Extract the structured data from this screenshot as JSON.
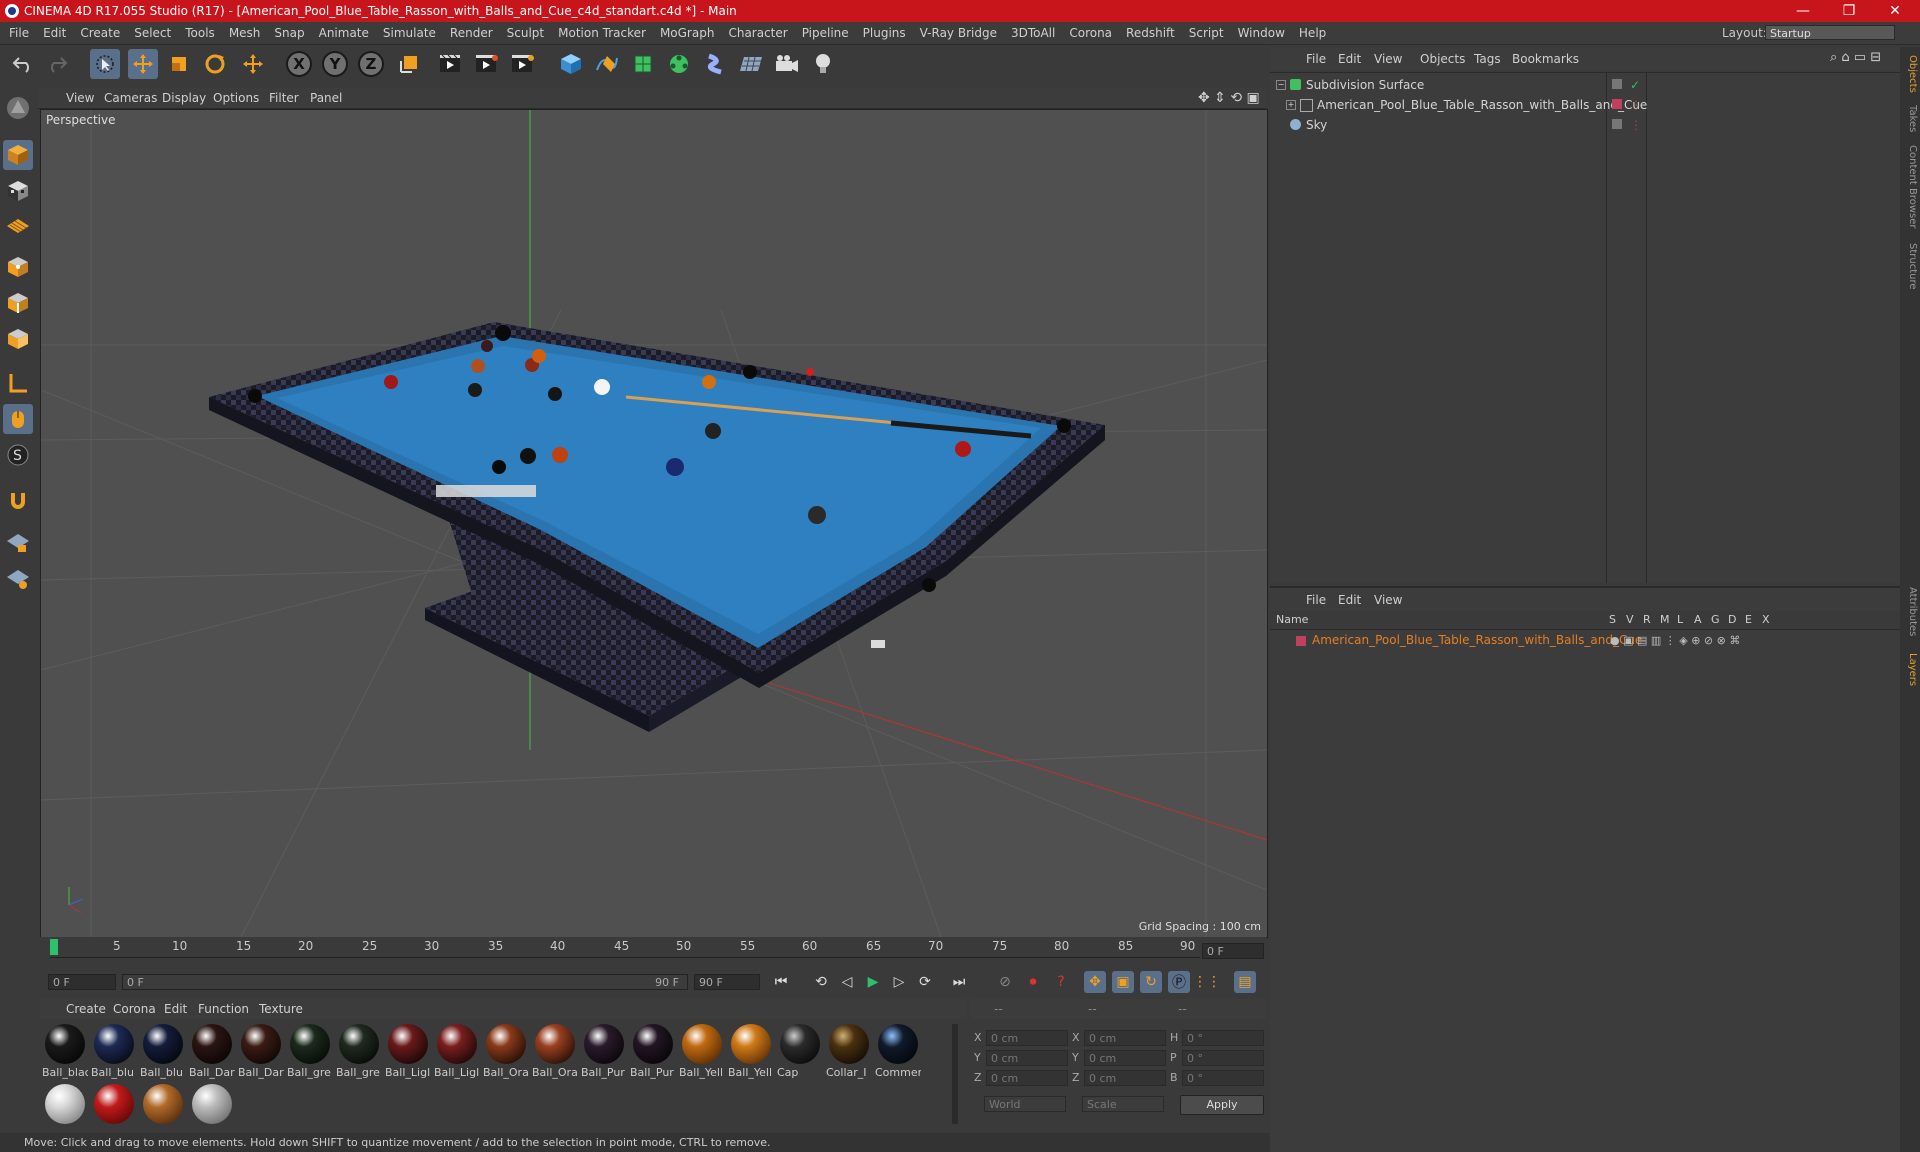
{
  "title_bar": {
    "title": "CINEMA 4D R17.055 Studio (R17) - [American_Pool_Blue_Table_Rasson_with_Balls_and_Cue_c4d_standart.c4d *] - Main",
    "minimize": "—",
    "maximize": "❐",
    "close": "✕"
  },
  "menubar": {
    "items": [
      "File",
      "Edit",
      "Create",
      "Select",
      "Tools",
      "Mesh",
      "Snap",
      "Animate",
      "Simulate",
      "Render",
      "Sculpt",
      "Motion Tracker",
      "MoGraph",
      "Character",
      "Pipeline",
      "Plugins",
      "V-Ray Bridge",
      "3DToAll",
      "Corona",
      "Redshift",
      "Script",
      "Window",
      "Help"
    ],
    "layout_label": "Layout:",
    "layout_value": "Startup"
  },
  "toolbar": {
    "axis_x": "X",
    "axis_y": "Y",
    "axis_z": "Z"
  },
  "viewport": {
    "menu": [
      "View",
      "Cameras",
      "Display",
      "Options",
      "Filter",
      "Panel"
    ],
    "label": "Perspective",
    "grid_spacing": "Grid Spacing : 100 cm"
  },
  "timeline": {
    "ticks": [
      "0",
      "5",
      "10",
      "15",
      "20",
      "25",
      "30",
      "35",
      "40",
      "45",
      "50",
      "55",
      "60",
      "65",
      "70",
      "75",
      "80",
      "85",
      "90"
    ],
    "end_field": "0 F"
  },
  "transport": {
    "start_field": "0 F",
    "range_start": "0 F",
    "range_end": "90 F",
    "end_field": "90 F"
  },
  "material_manager": {
    "menu": [
      "Create",
      "Corona",
      "Edit",
      "Function",
      "Texture"
    ],
    "materials": [
      {
        "label": "Ball_blac",
        "color": "#1a1a1a"
      },
      {
        "label": "Ball_blu",
        "color": "#1e2a55"
      },
      {
        "label": "Ball_blu",
        "color": "#141c3a"
      },
      {
        "label": "Ball_Dar",
        "color": "#2a1512"
      },
      {
        "label": "Ball_Dar",
        "color": "#3a1c14"
      },
      {
        "label": "Ball_gre",
        "color": "#1c2a1c"
      },
      {
        "label": "Ball_gre",
        "color": "#202a20"
      },
      {
        "label": "Ball_Ligl",
        "color": "#6a1a1a"
      },
      {
        "label": "Ball_Ligl",
        "color": "#7a1e1e"
      },
      {
        "label": "Ball_Ora",
        "color": "#8a3a1a"
      },
      {
        "label": "Ball_Ora",
        "color": "#9a4020"
      },
      {
        "label": "Ball_Pur",
        "color": "#2a1a2a"
      },
      {
        "label": "Ball_Pur",
        "color": "#221522"
      },
      {
        "label": "Ball_Yell",
        "color": "#c06a10"
      },
      {
        "label": "Ball_Yell",
        "color": "#d07a18"
      },
      {
        "label": "Cap",
        "color": "#2a2a2a"
      },
      {
        "label": "Collar_I",
        "color": "#4a3010"
      },
      {
        "label": "Commer",
        "color": "#101a2a"
      },
      {
        "label": "",
        "color": "#d8d8d8"
      },
      {
        "label": "",
        "color": "#c01a1a"
      },
      {
        "label": "",
        "color": "#b06a2a"
      },
      {
        "label": "",
        "color": "#bcbcbc"
      }
    ]
  },
  "coordinates": {
    "header": [
      "--",
      "--",
      "--"
    ],
    "rows": [
      {
        "a": "X",
        "av": "0 cm",
        "b": "X",
        "bv": "0 cm",
        "c": "H",
        "cv": "0 °"
      },
      {
        "a": "Y",
        "av": "0 cm",
        "b": "Y",
        "bv": "0 cm",
        "c": "P",
        "cv": "0 °"
      },
      {
        "a": "Z",
        "av": "0 cm",
        "b": "Z",
        "bv": "0 cm",
        "c": "B",
        "cv": "0 °"
      }
    ],
    "world": "World",
    "scale": "Scale",
    "apply": "Apply"
  },
  "status": "Move: Click and drag to move elements. Hold down SHIFT to quantize movement / add to the selection in point mode, CTRL to remove.",
  "object_manager": {
    "menu": [
      "File",
      "Edit",
      "View",
      "Objects",
      "Tags",
      "Bookmarks"
    ],
    "objects": [
      {
        "name": "Subdivision Surface"
      },
      {
        "name": "American_Pool_Blue_Table_Rasson_with_Balls_and_Cue"
      },
      {
        "name": "Sky"
      }
    ]
  },
  "layer_manager": {
    "menu": [
      "File",
      "Edit",
      "View"
    ],
    "columns": [
      "Name",
      "S",
      "V",
      "R",
      "M",
      "L",
      "A",
      "G",
      "D",
      "E",
      "X"
    ],
    "layers": [
      {
        "name": "American_Pool_Blue_Table_Rasson_with_Balls_and_Cue",
        "color": "#e67e22"
      }
    ]
  },
  "side_tabs": [
    "Objects",
    "Takes",
    "Content Browser",
    "Structure",
    "Attributes",
    "Layers"
  ],
  "maxon_logo": "MAXON CINEMA 4D"
}
